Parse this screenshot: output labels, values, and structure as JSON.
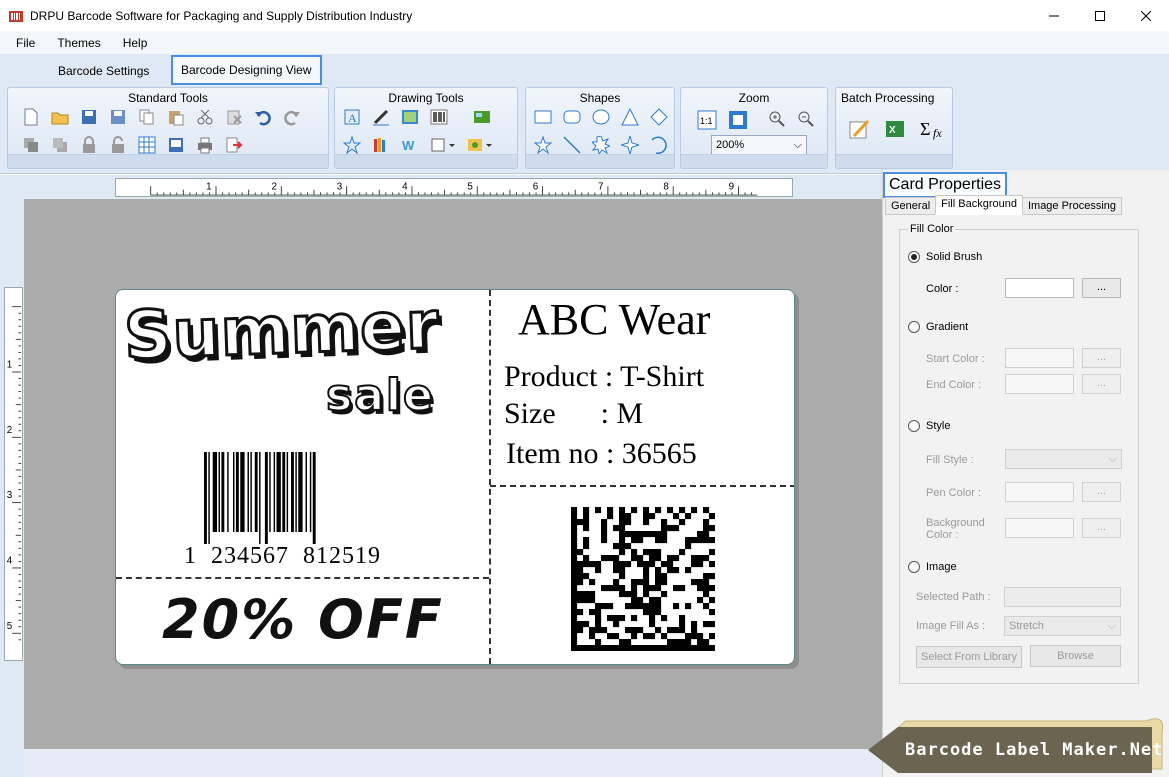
{
  "window": {
    "title": "DRPU Barcode Software for Packaging and Supply Distribution Industry"
  },
  "menu": [
    "File",
    "Themes",
    "Help"
  ],
  "tabs": {
    "barcode_settings": "Barcode Settings",
    "barcode_designing_view": "Barcode Designing View"
  },
  "ribbon": {
    "standard_tools": "Standard Tools",
    "drawing_tools": "Drawing Tools",
    "shapes": "Shapes",
    "zoom": "Zoom",
    "zoom_value": "200%",
    "batch_processing": "Batch Processing"
  },
  "ruler": {
    "h_ticks": [
      "1",
      "2",
      "3",
      "4",
      "5",
      "6",
      "7",
      "8",
      "9"
    ],
    "v_ticks": [
      "1",
      "2",
      "3",
      "4",
      "5"
    ]
  },
  "label": {
    "headline": "Summer",
    "subheadline": "sale",
    "barcode_number": "1  234567  812519",
    "discount": "20% OFF",
    "brand": "ABC Wear",
    "product_line": "Product : T-Shirt",
    "size_line": "Size      : M",
    "item_line": "Item no : 36565"
  },
  "card_properties": {
    "title": "Card Properties",
    "tabs": [
      "General",
      "Fill Background",
      "Image Processing"
    ],
    "fill_color_legend": "Fill Color",
    "solid_brush": "Solid Brush",
    "color_label": "Color :",
    "gradient": "Gradient",
    "start_color": "Start Color :",
    "end_color": "End Color :",
    "style": "Style",
    "fill_style": "Fill Style :",
    "pen_color": "Pen Color :",
    "background_color_line1": "Background",
    "background_color_line2": "Color :",
    "image": "Image",
    "selected_path": "Selected Path :",
    "image_fill_as": "Image Fill As :",
    "image_fill_value": "Stretch",
    "select_from_library": "Select From Library",
    "browse": "Browse",
    "dots": "..."
  },
  "brand_banner": "Barcode Label Maker.Net"
}
